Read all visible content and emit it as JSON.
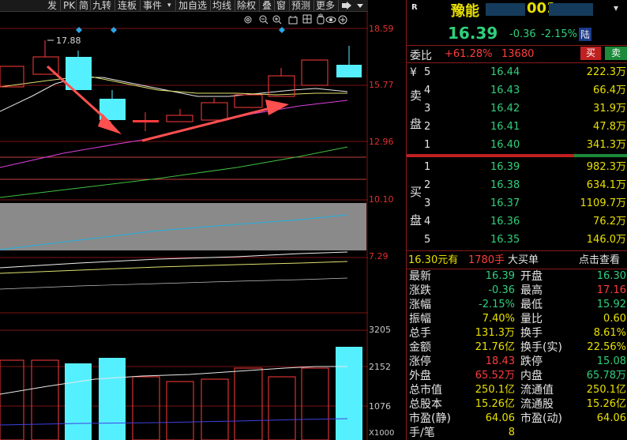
{
  "toolbar": {
    "items": [
      "发",
      "PK",
      "简",
      "九转",
      "连板",
      "事件",
      "",
      "加自选",
      "均线",
      "除权",
      "叠",
      "窗",
      "预测",
      "更多"
    ],
    "dropdown_glyph": "▾"
  },
  "chart_icons": [
    "gear-icon",
    "zoom-out-icon",
    "zoom-in-icon",
    "toolbox-icon",
    "grid-icon",
    "hand-icon",
    "eye-icon",
    "add-icon"
  ],
  "price_chart": {
    "high_marker": "17.88",
    "price_axis": [
      "18.59",
      "15.77",
      "12.96",
      "10.10",
      "7.29"
    ],
    "volume_axis": [
      "3205",
      "2152",
      "1076",
      "X1000"
    ]
  },
  "quote": {
    "market_flag": "R",
    "stock_name": "豫能",
    "stock_code_prefix": "001",
    "price": "16.39",
    "change": "-0.36",
    "change_pct": "-2.15%",
    "exchange_badge": "陆",
    "weibi_label": "委比",
    "weibi_value": "+61.28%",
    "weicha_value": "13680",
    "sell_button": "买",
    "buy_button": "卖"
  },
  "order_book": {
    "sell_label": [
      "卖",
      "盘"
    ],
    "buy_label": [
      "买",
      "盘"
    ],
    "asks": [
      {
        "level": "5",
        "price": "16.44",
        "volume": "222.3万"
      },
      {
        "level": "4",
        "price": "16.43",
        "volume": "66.4万"
      },
      {
        "level": "3",
        "price": "16.42",
        "volume": "31.9万"
      },
      {
        "level": "2",
        "price": "16.41",
        "volume": "47.8万"
      },
      {
        "level": "1",
        "price": "16.40",
        "volume": "341.3万"
      }
    ],
    "bids": [
      {
        "level": "1",
        "price": "16.39",
        "volume": "982.3万"
      },
      {
        "level": "2",
        "price": "16.38",
        "volume": "634.1万"
      },
      {
        "level": "3",
        "price": "16.37",
        "volume": "1109.7万"
      },
      {
        "level": "4",
        "price": "16.36",
        "volume": "76.2万"
      },
      {
        "level": "5",
        "price": "16.35",
        "volume": "146.0万"
      }
    ]
  },
  "big_order": {
    "price": "16.30元有",
    "volume": "1780手",
    "label": "大买单",
    "link": "点击查看"
  },
  "stats": [
    {
      "k1": "最新",
      "v1": "16.39",
      "c1": "green",
      "k2": "开盘",
      "v2": "16.30",
      "c2": "green"
    },
    {
      "k1": "涨跌",
      "v1": "-0.36",
      "c1": "green",
      "k2": "最高",
      "v2": "17.16",
      "c2": "red"
    },
    {
      "k1": "涨幅",
      "v1": "-2.15%",
      "c1": "green",
      "k2": "最低",
      "v2": "15.92",
      "c2": "green"
    },
    {
      "k1": "振幅",
      "v1": "7.40%",
      "c1": "yellow",
      "k2": "量比",
      "v2": "0.60",
      "c2": "yellow"
    },
    {
      "k1": "总手",
      "v1": "131.3万",
      "c1": "yellow",
      "k2": "换手",
      "v2": "8.61%",
      "c2": "yellow"
    },
    {
      "k1": "金额",
      "v1": "21.76亿",
      "c1": "yellow",
      "k2": "换手(实)",
      "v2": "22.56%",
      "c2": "yellow"
    },
    {
      "k1": "涨停",
      "v1": "18.43",
      "c1": "red",
      "k2": "跌停",
      "v2": "15.08",
      "c2": "green"
    },
    {
      "k1": "外盘",
      "v1": "65.52万",
      "c1": "red",
      "k2": "内盘",
      "v2": "65.78万",
      "c2": "green"
    },
    {
      "k1": "总市值",
      "v1": "250.1亿",
      "c1": "yellow",
      "k2": "流通值",
      "v2": "250.1亿",
      "c2": "yellow"
    },
    {
      "k1": "总股本",
      "v1": "15.26亿",
      "c1": "yellow",
      "k2": "流通股",
      "v2": "15.26亿",
      "c2": "yellow"
    },
    {
      "k1": "市盈(静)",
      "v1": "64.06",
      "c1": "yellow",
      "k2": "市盈(动)",
      "v2": "64.06",
      "c2": "yellow"
    },
    {
      "k1": "手/笔",
      "v1": "8",
      "c1": "yellow",
      "k2": "",
      "v2": "",
      "c2": "yellow"
    }
  ],
  "colors": {
    "up": "#ff3c3c",
    "down": "#2fd07c",
    "candle_down_fill": "#55f0ff",
    "accent_red": "#c02020"
  }
}
